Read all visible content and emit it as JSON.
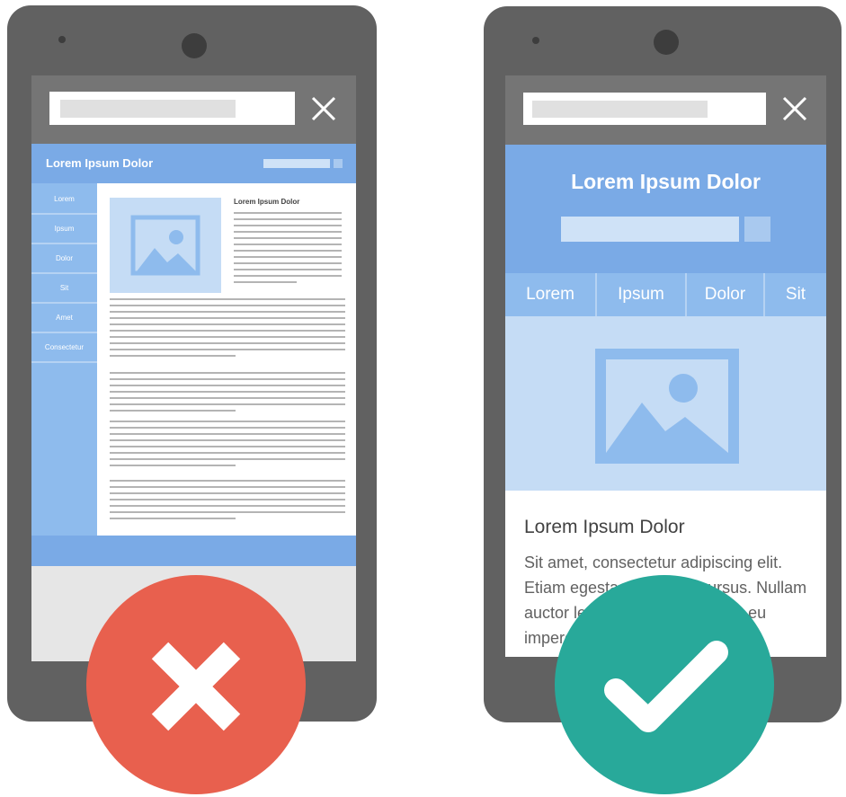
{
  "bad_phone": {
    "page_title": "Lorem Ipsum Dolor",
    "sidebar": [
      "Lorem",
      "Ipsum",
      "Dolor",
      "Sit",
      "Amet",
      "Consectetur"
    ],
    "article_heading": "Lorem Ipsum Dolor"
  },
  "good_phone": {
    "page_title": "Lorem Ipsum Dolor",
    "tabs": [
      "Lorem",
      "Ipsum",
      "Dolor",
      "Sit"
    ],
    "article_heading": "Lorem Ipsum Dolor",
    "article_text": "Sit amet, consectetur adipiscing elit. Etiam egestas hendrerit cursus. Nullam auctor lectus ac enim rhoncus, eu imperdiet erat"
  },
  "icons": {
    "url_close": "close-icon",
    "image_placeholder": "image-icon",
    "bad_badge": "x-icon",
    "good_badge": "checkmark-icon"
  },
  "colors": {
    "phone_body": "#616161",
    "header_blue": "#7aaae6",
    "bad_badge": "#e8604e",
    "good_badge": "#28a99a"
  }
}
